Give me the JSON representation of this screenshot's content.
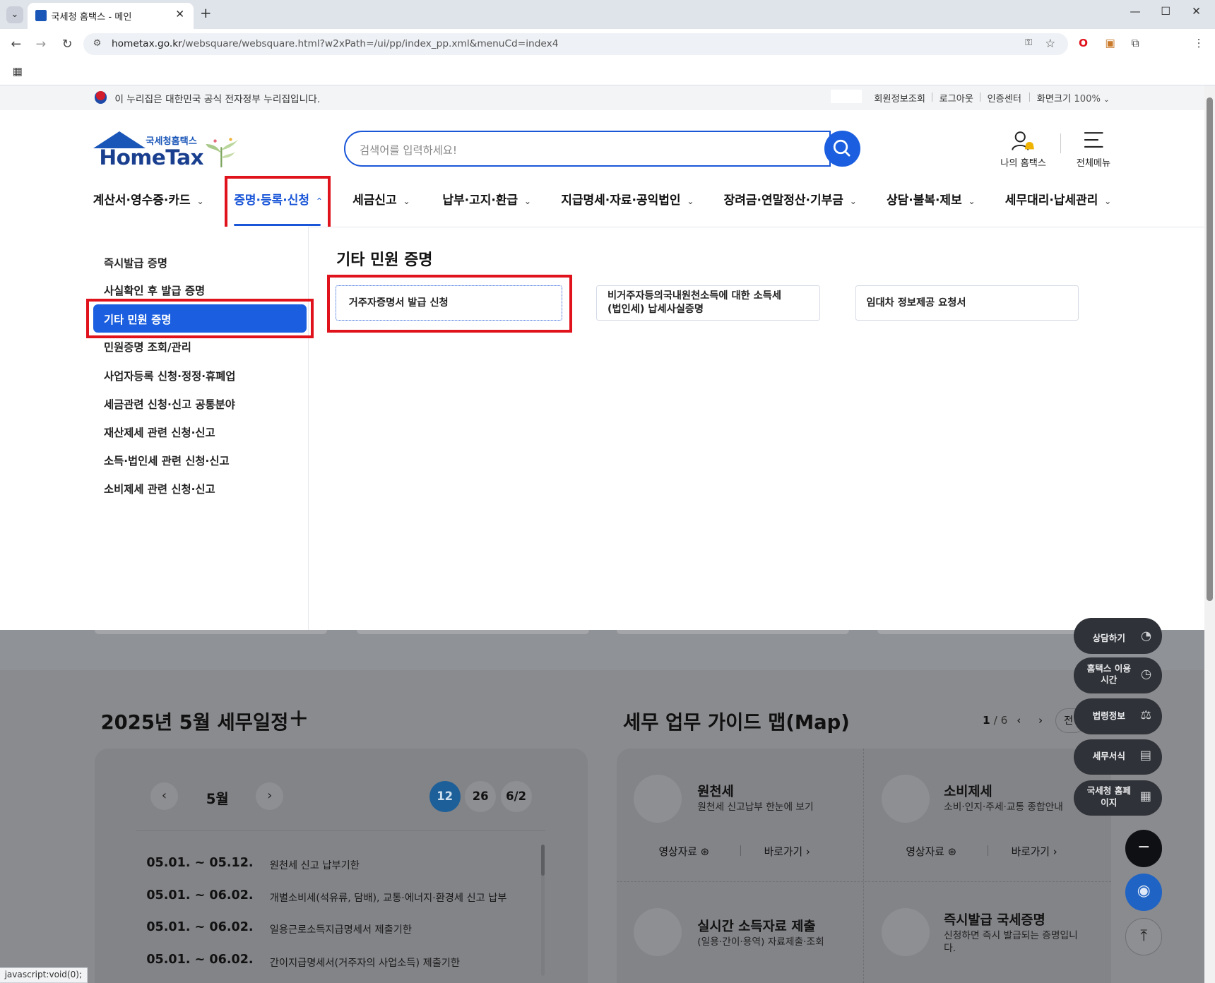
{
  "browser": {
    "tab_title": "국세청 홈택스 - 메인",
    "url_host": "hometax.go.kr",
    "url_path": "/websquare/websquare.html?w2xPath=/ui/pp/index_pp.xml&menuCd=index4",
    "status_text": "javascript:void(0);"
  },
  "govbar": {
    "notice": "이 누리집은 대한민국 공식 전자정부 누리집입니다.",
    "links": [
      "회원정보조회",
      "로그아웃",
      "인증센터"
    ],
    "zoom_label": "화면크기",
    "zoom_value": "100%"
  },
  "header": {
    "logo_small": "국세청홈택스",
    "logo_big": "HomeTax",
    "search_placeholder": "검색어를 입력하세요!",
    "my_hometax": "나의 홈택스",
    "all_menu": "전체메뉴"
  },
  "gnb": [
    {
      "label": "계산서·영수증·카드",
      "active": false
    },
    {
      "label": "증명·등록·신청",
      "active": true
    },
    {
      "label": "세금신고",
      "active": false
    },
    {
      "label": "납부·고지·환급",
      "active": false
    },
    {
      "label": "지급명세·자료·공익법인",
      "active": false
    },
    {
      "label": "장려금·연말정산·기부금",
      "active": false
    },
    {
      "label": "상담·불복·제보",
      "active": false
    },
    {
      "label": "세무대리·납세관리",
      "active": false
    }
  ],
  "lnb": [
    "즉시발급 증명",
    "사실확인 후 발급 증명",
    "기타 민원 증명",
    "민원증명 조회/관리",
    "사업자등록 신청·정정·휴폐업",
    "세금관련 신청·신고 공통분야",
    "재산제세 관련 신청·신고",
    "소득·법인세 관련 신청·신고",
    "소비제세 관련 신청·신고"
  ],
  "submenu": {
    "title": "기타 민원 증명",
    "items": [
      "거주자증명서 발급 신청",
      "비거주자등의국내원천소득에 대한 소득세",
      "(법인세) 납세사실증명",
      "임대차 정보제공 요청서"
    ]
  },
  "schedule": {
    "title": "2025년 5월 세무일정",
    "month": "5월",
    "dates": [
      "12",
      "26",
      "6/2"
    ],
    "rows": [
      {
        "date": "05.01. ~ 05.12.",
        "desc": "원천세 신고 납부기한"
      },
      {
        "date": "05.01. ~ 06.02.",
        "desc": "개별소비세(석유류, 담배), 교통·에너지·환경세 신고 납부"
      },
      {
        "date": "05.01. ~ 06.02.",
        "desc": "일용근로소득지급명세서 제출기한"
      },
      {
        "date": "05.01. ~ 06.02.",
        "desc": "간이지급명세서(거주자의 사업소득) 제출기한"
      }
    ]
  },
  "guide_map": {
    "title": "세무 업무 가이드 맵(Map)",
    "page_current": "1",
    "page_total": "/ 6",
    "all_label": "전",
    "cards": [
      {
        "name": "원천세",
        "sub": "원천세 신고납부 한눈에 보기",
        "video": "영상자료",
        "go": "바로가기"
      },
      {
        "name": "소비제세",
        "sub": "소비·인지·주세·교통 종합안내",
        "video": "영상자료",
        "go": "바로가기"
      },
      {
        "name": "실시간 소득자료 제출",
        "sub": "(일용·간이·용역) 자료제출·조회"
      },
      {
        "name": "즉시발급 국세증명",
        "sub": "신청하면 즉시 발급되는 증명입니다."
      }
    ]
  },
  "floating": [
    {
      "label": "상담하기"
    },
    {
      "label": "홈택스 이용시간"
    },
    {
      "label": "법령정보"
    },
    {
      "label": "세무서식"
    },
    {
      "label": "국세청 홈페이지"
    }
  ]
}
